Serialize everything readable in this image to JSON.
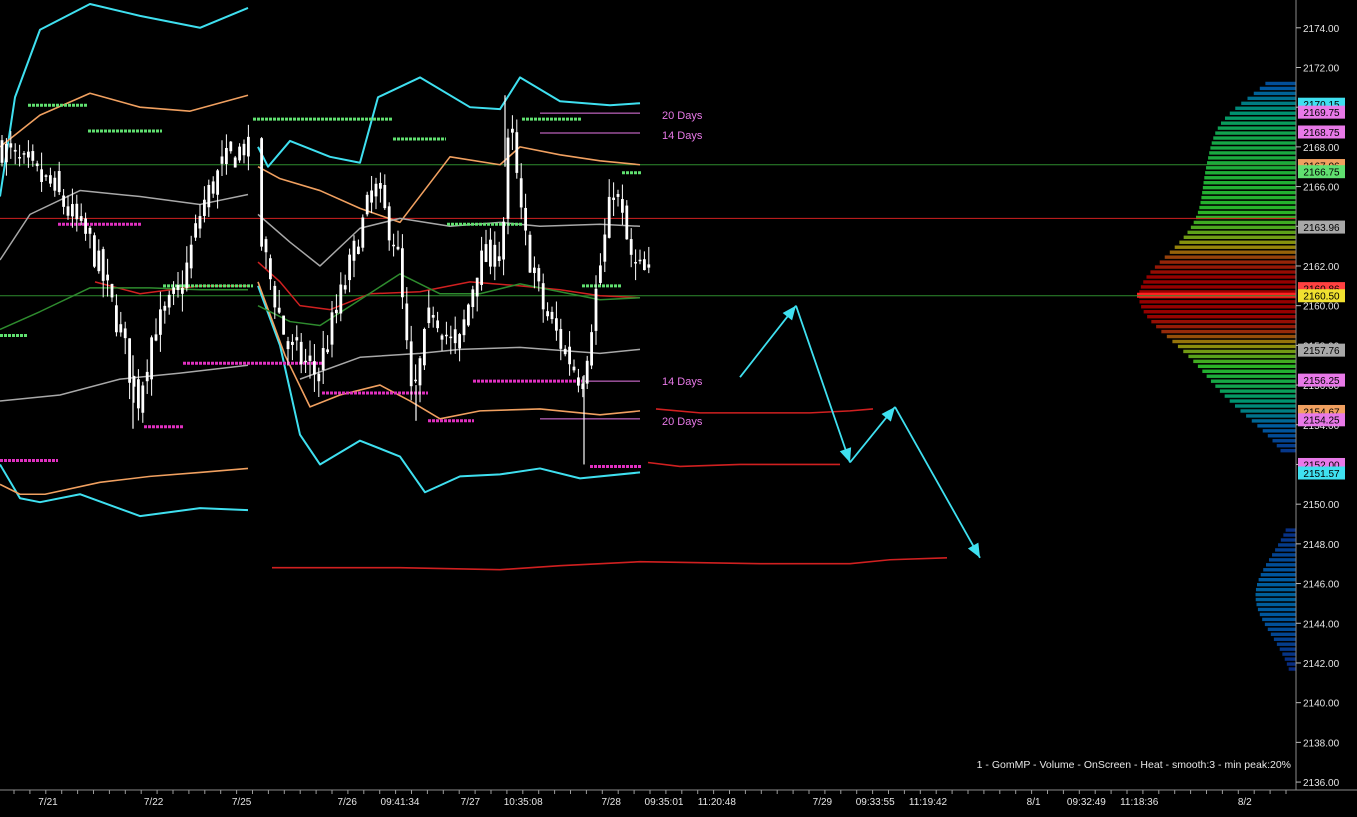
{
  "chart_data": {
    "type": "candlestick",
    "title": "",
    "footer": "1 - GomMP - Volume - OnScreen - Heat - smooth:3 - min peak:20%",
    "y_axis": {
      "ticks": [
        "2174.00",
        "2172.00",
        "2170.00",
        "2168.00",
        "2166.00",
        "2164.00",
        "2162.00",
        "2160.00",
        "2158.00",
        "2156.00",
        "2154.00",
        "2152.00",
        "2150.00",
        "2148.00",
        "2146.00",
        "2144.00",
        "2142.00",
        "2140.00",
        "2138.00",
        "2136.00"
      ],
      "ylim": [
        2135.6,
        2175.4
      ]
    },
    "x_axis": {
      "ticks": [
        {
          "label": "7/21",
          "i": 2
        },
        {
          "label": "7/22",
          "i": 8
        },
        {
          "label": "7/25",
          "i": 13
        },
        {
          "label": "7/26",
          "i": 19
        },
        {
          "label": "09:41:34",
          "i": 22
        },
        {
          "label": "7/27",
          "i": 26
        },
        {
          "label": "10:35:08",
          "i": 29
        },
        {
          "label": "7/28",
          "i": 34
        },
        {
          "label": "09:35:01",
          "i": 37
        },
        {
          "label": "11:20:48",
          "i": 40
        },
        {
          "label": "7/29",
          "i": 46
        },
        {
          "label": "09:33:55",
          "i": 49
        },
        {
          "label": "11:19:42",
          "i": 52
        },
        {
          "label": "8/1",
          "i": 58
        },
        {
          "label": "09:32:49",
          "i": 61
        },
        {
          "label": "11:18:36",
          "i": 64
        },
        {
          "label": "8/2",
          "i": 70
        }
      ]
    },
    "price_tags": [
      {
        "value": "2170.15",
        "color": "#3fe0f0"
      },
      {
        "value": "2169.75",
        "color": "#e879e8"
      },
      {
        "value": "2168.75",
        "color": "#e879e8"
      },
      {
        "value": "2167.06",
        "color": "#f0a060"
      },
      {
        "value": "2166.75",
        "color": "#60e070"
      },
      {
        "value": "2163.96",
        "color": "#a8a8a8"
      },
      {
        "value": "2160.86",
        "color": "#ff4040"
      },
      {
        "value": "2160.50",
        "color": "#f0e030"
      },
      {
        "value": "2157.76",
        "color": "#a8a8a8"
      },
      {
        "value": "2156.25",
        "color": "#e879e8"
      },
      {
        "value": "2154.67",
        "color": "#f0a060"
      },
      {
        "value": "2154.25",
        "color": "#e879e8"
      },
      {
        "value": "2152.00",
        "color": "#e879e8"
      },
      {
        "value": "2151.57",
        "color": "#3fe0f0"
      }
    ],
    "horizontal_lines": [
      {
        "value": 2167.1,
        "color": "#2e8b2e"
      },
      {
        "value": 2164.4,
        "color": "#d02020"
      },
      {
        "value": 2160.5,
        "color": "#2e8b2e"
      }
    ],
    "annotations": [
      {
        "text": "20 Days",
        "value": 2169.6
      },
      {
        "text": "14 Days",
        "value": 2168.6
      },
      {
        "text": "14 Days",
        "value": 2156.2
      },
      {
        "text": "20 Days",
        "value": 2154.2
      }
    ],
    "candle_price_range": [
      2153.8,
      2170.6
    ],
    "volume_profile_peak": 2160.5,
    "colors": {
      "candle": "#ffffff",
      "upper_band": "#3fe0f0",
      "mid_band": "#f0a060",
      "mean": "#a8a8a8",
      "vwap": "#d02020",
      "ma": "#2e8b2e",
      "green_level": "#60e070",
      "magenta_level": "#e030c0",
      "arrow": "#3fe0f0"
    }
  }
}
